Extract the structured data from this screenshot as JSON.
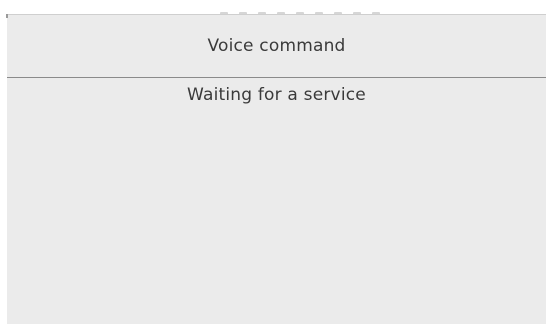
{
  "dialog": {
    "title": "Voice command",
    "status": "Waiting for a service"
  }
}
